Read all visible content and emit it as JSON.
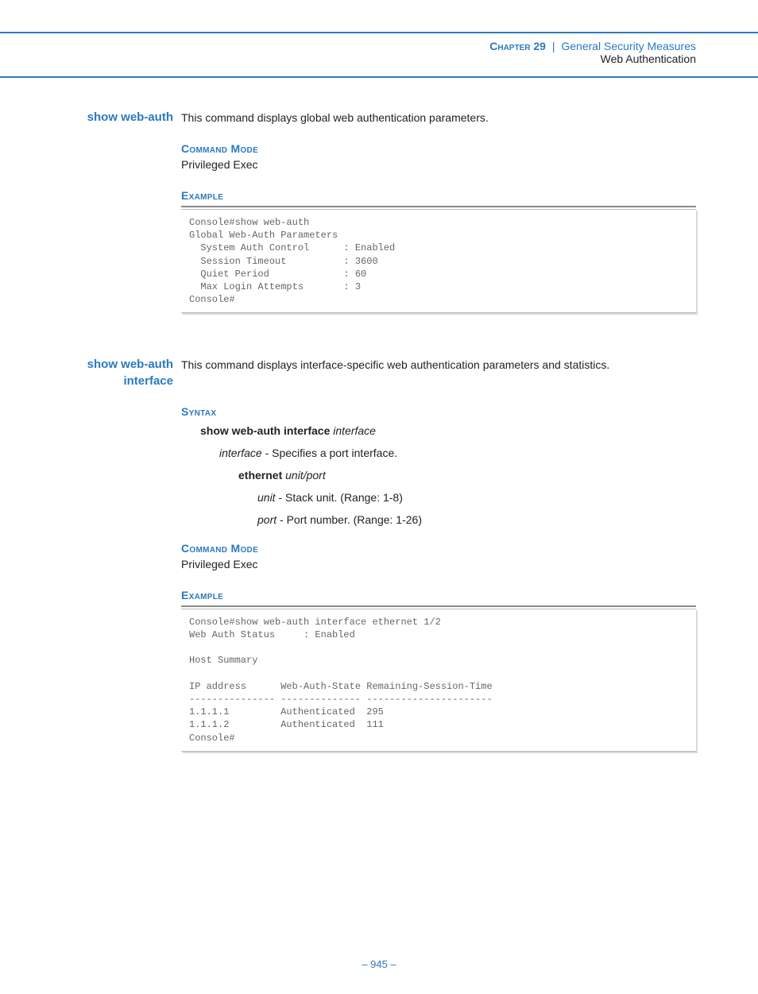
{
  "header": {
    "chapter_label": "Chapter 29",
    "chapter_title": "General Security Measures",
    "subtitle": "Web Authentication"
  },
  "cmd1": {
    "name": "show web-auth",
    "desc": "This command displays global web authentication parameters.",
    "mode_title": "Command Mode",
    "mode_body": "Privileged Exec",
    "example_title": "Example",
    "code": "Console#show web-auth\nGlobal Web-Auth Parameters\n  System Auth Control      : Enabled\n  Session Timeout          : 3600\n  Quiet Period             : 60\n  Max Login Attempts       : 3\nConsole#"
  },
  "cmd2": {
    "name": "show web-auth interface",
    "desc": "This command displays interface-specific web authentication parameters and statistics.",
    "syntax_title": "Syntax",
    "syntax_cmd_bold": "show web-auth interface",
    "syntax_cmd_ital": "interface",
    "syntax_iface_ital": "interface",
    "syntax_iface_desc": " - Specifies a port interface.",
    "syntax_eth_bold": "ethernet",
    "syntax_eth_ital": "unit/port",
    "syntax_unit_ital": "unit",
    "syntax_unit_desc": " - Stack unit. (Range: 1-8)",
    "syntax_port_ital": "port",
    "syntax_port_desc": " - Port number. (Range: 1-26)",
    "mode_title": "Command Mode",
    "mode_body": "Privileged Exec",
    "example_title": "Example",
    "code": "Console#show web-auth interface ethernet 1/2\nWeb Auth Status     : Enabled\n\nHost Summary\n\nIP address      Web-Auth-State Remaining-Session-Time\n--------------- -------------- ----------------------\n1.1.1.1         Authenticated  295\n1.1.1.2         Authenticated  111\nConsole#"
  },
  "page_number": "– 945 –"
}
